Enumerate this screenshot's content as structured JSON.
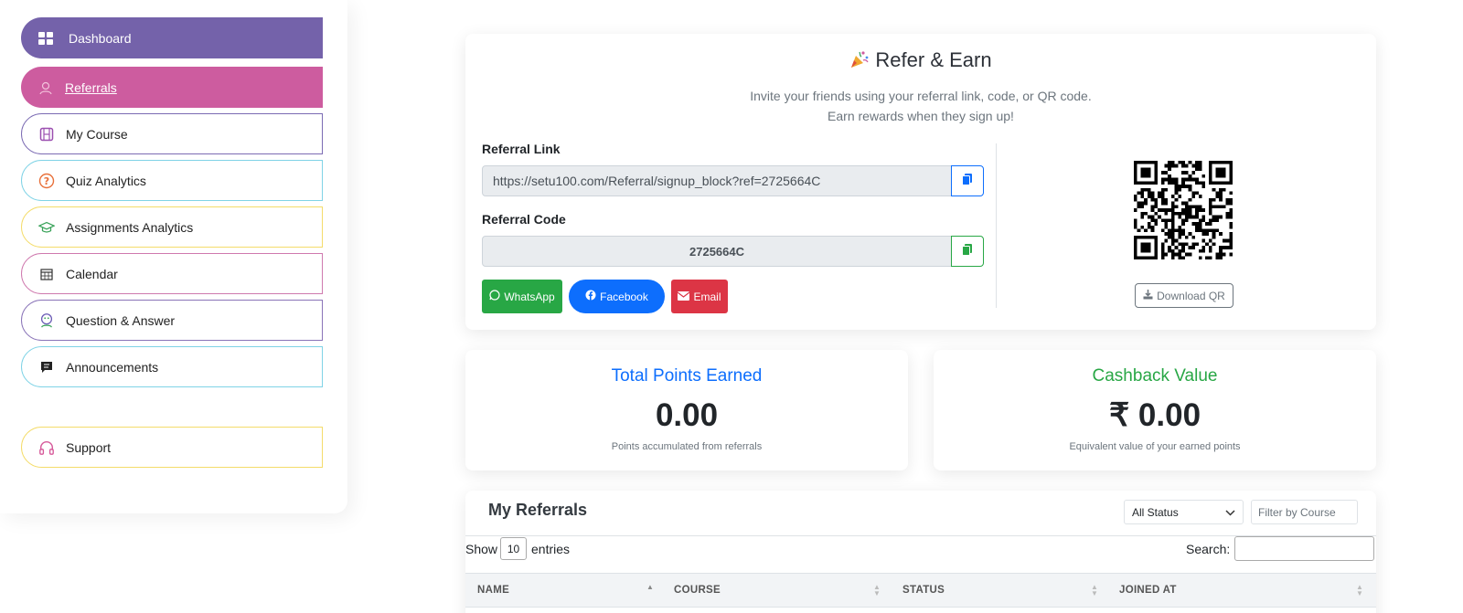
{
  "sidebar": {
    "items": [
      {
        "label": "Dashboard",
        "icon": "grid-icon"
      },
      {
        "label": "Referrals",
        "icon": "referral-icon"
      },
      {
        "label": "My Course",
        "icon": "film-icon"
      },
      {
        "label": "Quiz Analytics",
        "icon": "question-icon"
      },
      {
        "label": "Assignments Analytics",
        "icon": "graduation-cap-icon"
      },
      {
        "label": "Calendar",
        "icon": "calendar-icon"
      },
      {
        "label": "Question & Answer",
        "icon": "qa-icon"
      },
      {
        "label": "Announcements",
        "icon": "message-icon"
      }
    ],
    "support": {
      "label": "Support",
      "icon": "headphones-icon"
    }
  },
  "refer": {
    "title": "Refer & Earn",
    "subtitle_line1": "Invite your friends using your referral link, code, or QR code.",
    "subtitle_line2": "Earn rewards when they sign up!",
    "link_label": "Referral Link",
    "link_value": "https://setu100.com/Referral/signup_block?ref=2725664C",
    "code_label": "Referral Code",
    "code_value": "2725664C",
    "whatsapp": "WhatsApp",
    "facebook": "Facebook",
    "email": "Email",
    "download_qr": "Download QR"
  },
  "stats": {
    "points_title": "Total Points Earned",
    "points_value": "0.00",
    "points_desc": "Points accumulated from referrals",
    "cashback_title": "Cashback Value",
    "cashback_value": "₹ 0.00",
    "cashback_desc": "Equivalent value of your earned points"
  },
  "referrals": {
    "title": "My Referrals",
    "status_filter": "All Status",
    "course_placeholder": "Filter by Course",
    "show": "Show",
    "entries_value": "10",
    "entries": "entries",
    "search_label": "Search:",
    "columns": [
      "NAME",
      "COURSE",
      "STATUS",
      "JOINED AT"
    ]
  },
  "colors": {
    "primary": "#0d6efd",
    "success": "#28a745",
    "danger": "#dc3545",
    "sidebar_purple": "#7462aa",
    "sidebar_pink": "#cd5c9f"
  }
}
